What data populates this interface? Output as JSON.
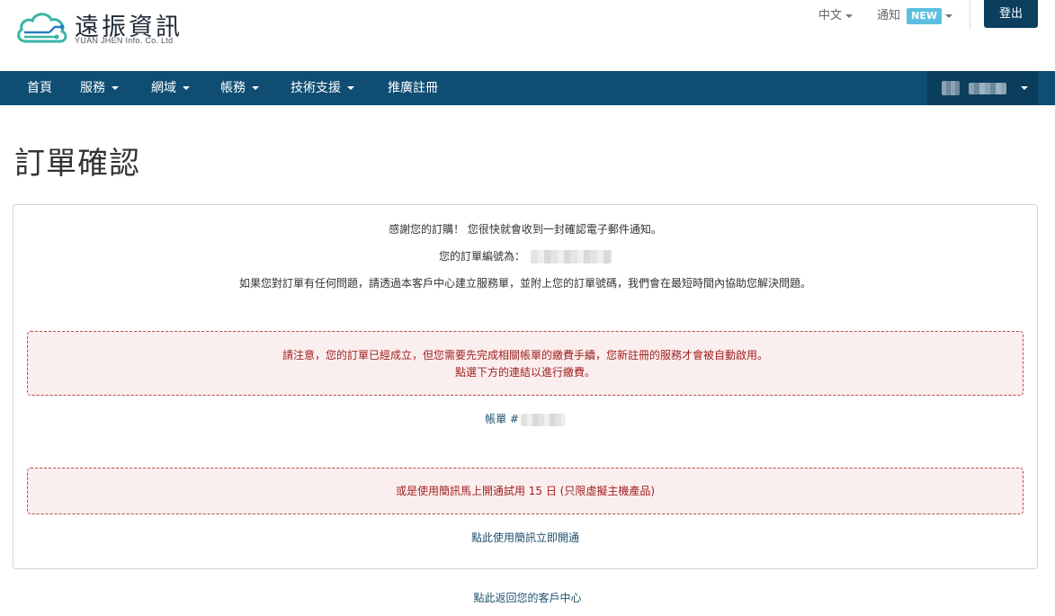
{
  "brand": {
    "name": "遠振資訊",
    "subtitle": "YUAN JHEN Info. Co. Ltd",
    "colors": {
      "cloud_teal": "#3ab5a6",
      "cloud_blue": "#2a7fbf",
      "nav_bg": "#0f4d73",
      "logout_bg": "#0c3f5d"
    }
  },
  "topbar": {
    "language": "中文",
    "notify_label": "通知",
    "notify_badge": "NEW",
    "logout": "登出"
  },
  "nav": {
    "items": [
      {
        "label": "首頁",
        "dropdown": false
      },
      {
        "label": "服務",
        "dropdown": true
      },
      {
        "label": "網域",
        "dropdown": true
      },
      {
        "label": "帳務",
        "dropdown": true
      },
      {
        "label": "技術支援",
        "dropdown": true
      },
      {
        "label": "推廣註冊",
        "dropdown": false
      }
    ],
    "account_icon": "chevron-down-icon"
  },
  "page": {
    "title": "訂單確認"
  },
  "confirmation": {
    "thanks": "感謝您的訂購！ 您很快就會收到一封確認電子郵件通知。",
    "order_number_label": "您的訂單編號為：",
    "help_text": "如果您對訂單有任何問題，請透過本客戶中心建立服務單，並附上您的訂單號碼，我們會在最短時間內協助您解決問題。",
    "notice_line1": "請注意，您的訂單已經成立，但您需要先完成相關帳單的繳費手續，您新註冊的服務才會被自動啟用。",
    "notice_line2": "點選下方的連結以進行繳費。",
    "invoice_label": "帳單 #",
    "sms_notice": "或是使用簡訊馬上開通試用 15 日 (只限虛擬主機產品)",
    "sms_link": "點此使用簡訊立即開通"
  },
  "footer": {
    "back_link": "點此返回您的客戶中心"
  }
}
